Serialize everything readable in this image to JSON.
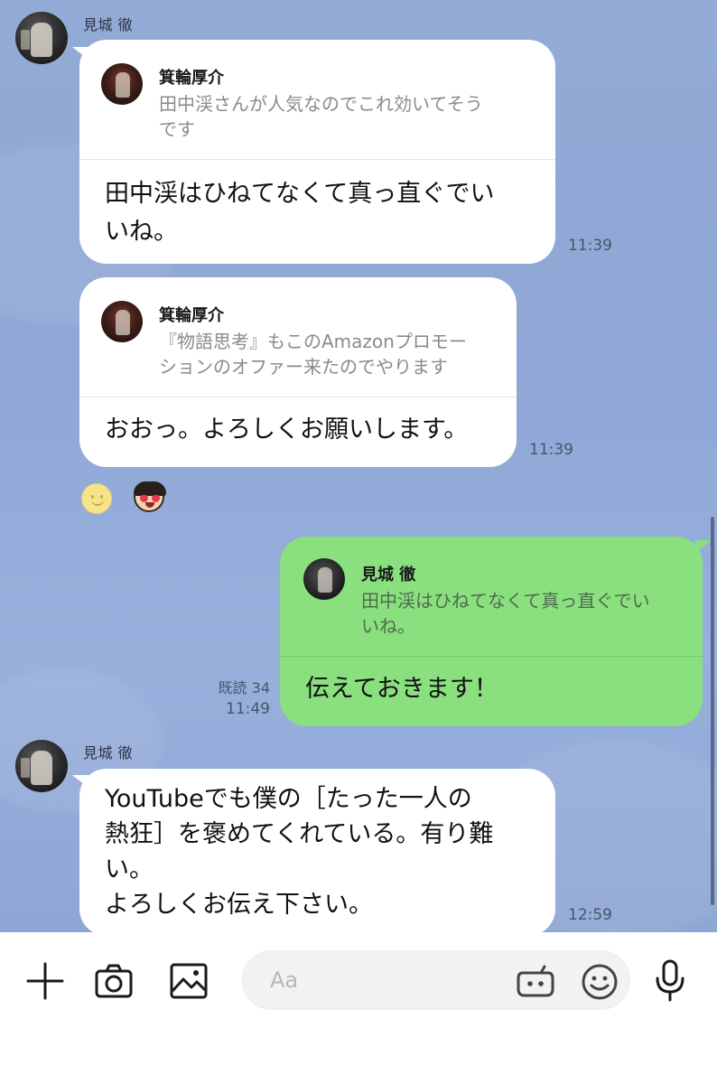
{
  "messages": [
    {
      "sender": "見城 徹",
      "reply": {
        "name": "箕輪厚介",
        "text_line1": "田中渓さんが人気なのでこれ効いてそう",
        "text_line2": "です"
      },
      "text_line1": "田中渓はひねてなくて真っ直ぐでい",
      "text_line2": "いね。",
      "time": "11:39"
    },
    {
      "reply": {
        "name": "箕輪厚介",
        "text_line1": "『物語思考』もこのAmazonプロモー",
        "text_line2": "ションのオファー来たのでやります"
      },
      "text_line1": "おおっ。よろしくお願いします。",
      "time": "11:39",
      "reactions": [
        "smile-reaction-icon",
        "heart-eyes-face-icon"
      ]
    },
    {
      "outgoing": true,
      "reply": {
        "name": "見城 徹",
        "text_line1": "田中渓はひねてなくて真っ直ぐでい",
        "text_line2": "いね。"
      },
      "text_line1": "伝えておきます！",
      "read": "既読 34",
      "time": "11:49"
    },
    {
      "sender": "見城 徹",
      "text_line1": "YouTubeでも僕の［たった一人の",
      "text_line2": "熱狂］を褒めてくれている。有り難",
      "text_line3": "い。",
      "text_line4": "よろしくお伝え下さい。",
      "time": "12:59"
    }
  ],
  "input": {
    "placeholder": "Aa",
    "icons": [
      "plus-icon",
      "camera-icon",
      "image-icon",
      "sticker-icon",
      "emoji-icon",
      "microphone-icon"
    ]
  },
  "colors": {
    "chat_background": "#93aad6",
    "incoming_bubble": "#ffffff",
    "outgoing_bubble": "#8ae07f"
  }
}
